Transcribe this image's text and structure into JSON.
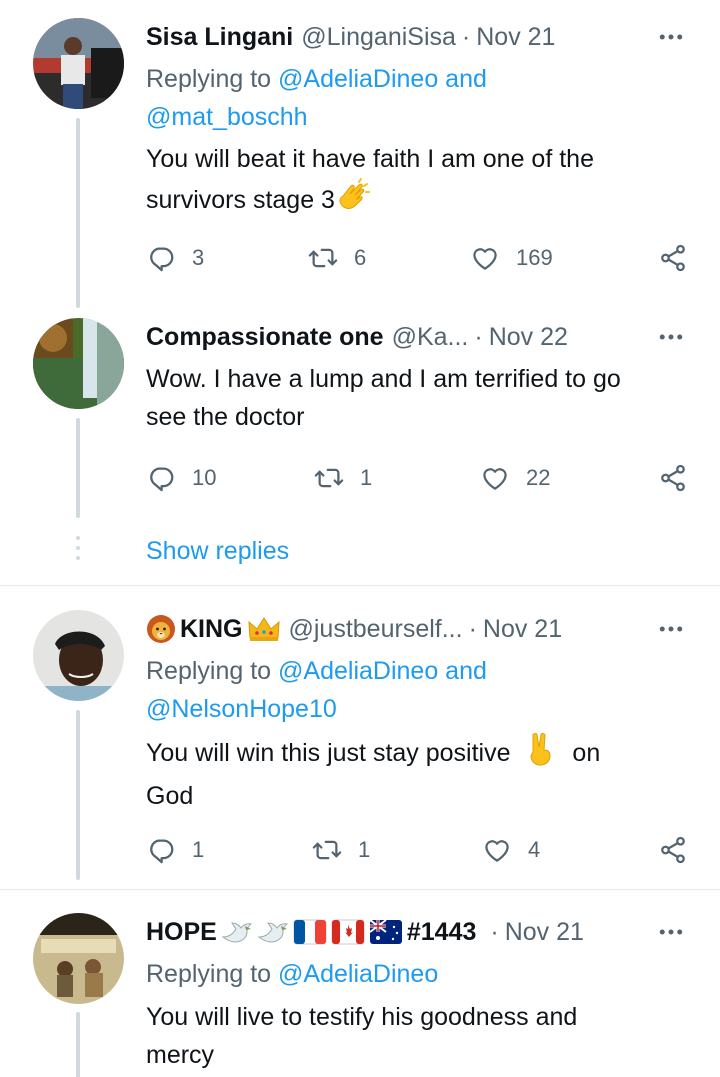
{
  "tweets": [
    {
      "name": "Sisa Lingani",
      "handle": "@LinganiSisa",
      "sep": "·",
      "date": "Nov 21",
      "replying_prefix": "Replying to ",
      "replying_link_line1": "@AdeliaDineo and",
      "replying_link_line2": "@mat_boschh",
      "text_line1": "You will beat it have faith I am one of the",
      "text_line2": "survivors stage 3",
      "replies": "3",
      "retweets": "6",
      "likes": "169"
    },
    {
      "name": "Compassionate one",
      "handle": "@Ka...",
      "sep": "·",
      "date": "Nov 22",
      "text_line1": "Wow. I have a lump and I am terrified to go",
      "text_line2": "see the doctor",
      "replies": "10",
      "retweets": "1",
      "likes": "22"
    },
    {
      "name": "KING",
      "handle": "@justbeurself...",
      "sep": "·",
      "date": "Nov 21",
      "replying_prefix": "Replying to ",
      "replying_link_line1": "@AdeliaDineo and",
      "replying_link_line2": "@NelsonHope10",
      "text_line1_a": "You will win this just stay positive",
      "text_line1_b": "on",
      "text_line2": "God",
      "replies": "1",
      "retweets": "1",
      "likes": "4"
    },
    {
      "name_prefix": "HOPE",
      "name_suffix": "#1443",
      "sep": "·",
      "date": "Nov 21",
      "replying_prefix": "Replying to ",
      "replying_link_line1": "@AdeliaDineo",
      "text_line1": "You will live to testify his goodness and",
      "text_line2": "mercy"
    }
  ],
  "show_replies": "Show replies",
  "icons": {
    "reply": "reply-icon",
    "retweet": "retweet-icon",
    "like": "heart-icon",
    "share": "share-icon",
    "more": "more-icon",
    "clap": "clapping-hands-emoji",
    "lion": "lion-emoji",
    "crown": "crown-emoji",
    "victory": "victory-hand-emoji",
    "dove": "dove-emoji",
    "flag_fr": "france-flag-emoji",
    "flag_ca": "canada-flag-emoji",
    "flag_au": "australia-flag-emoji"
  },
  "colors": {
    "link": "#1d9bf0",
    "secondary_text": "#536471",
    "primary_text": "#0f1419",
    "thread_line": "#cfd9de",
    "divider": "#e7e9ea"
  }
}
